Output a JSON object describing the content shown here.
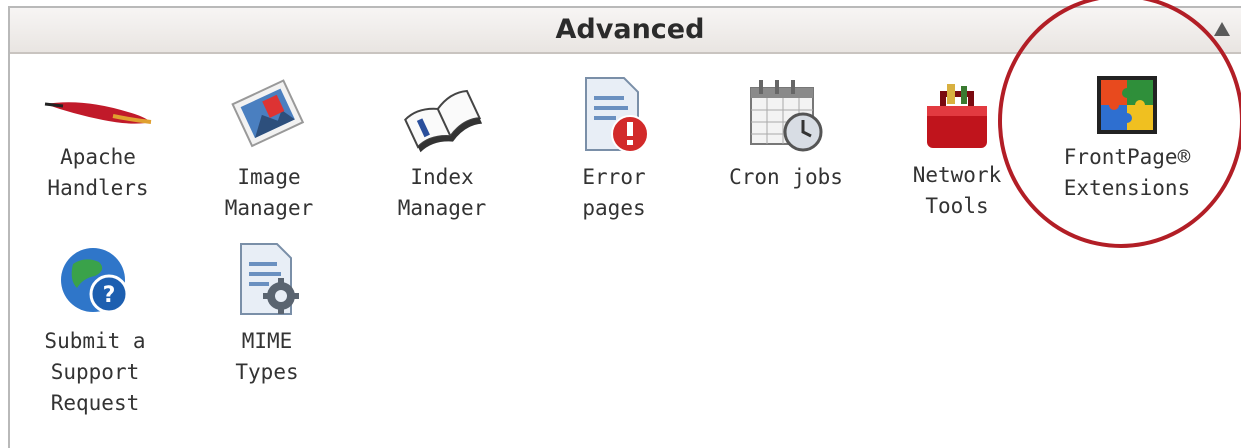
{
  "panel": {
    "title": "Advanced",
    "items": [
      {
        "label": "Apache\nHandlers",
        "icon": "feather-icon"
      },
      {
        "label": "Image\nManager",
        "icon": "picture-icon"
      },
      {
        "label": "Index\nManager",
        "icon": "book-icon"
      },
      {
        "label": "Error\npages",
        "icon": "error-document-icon"
      },
      {
        "label": "Cron jobs",
        "icon": "calendar-clock-icon"
      },
      {
        "label": "Network\nTools",
        "icon": "toolbox-icon"
      },
      {
        "label": "FrontPage®\nExtensions",
        "icon": "puzzle-icon"
      },
      {
        "label": "Submit a\nSupport\nRequest",
        "icon": "help-globe-icon"
      },
      {
        "label": "MIME\nTypes",
        "icon": "document-gear-icon"
      }
    ]
  },
  "colors": {
    "highlight": "#b21e26",
    "header_text": "#2b2b2b"
  }
}
